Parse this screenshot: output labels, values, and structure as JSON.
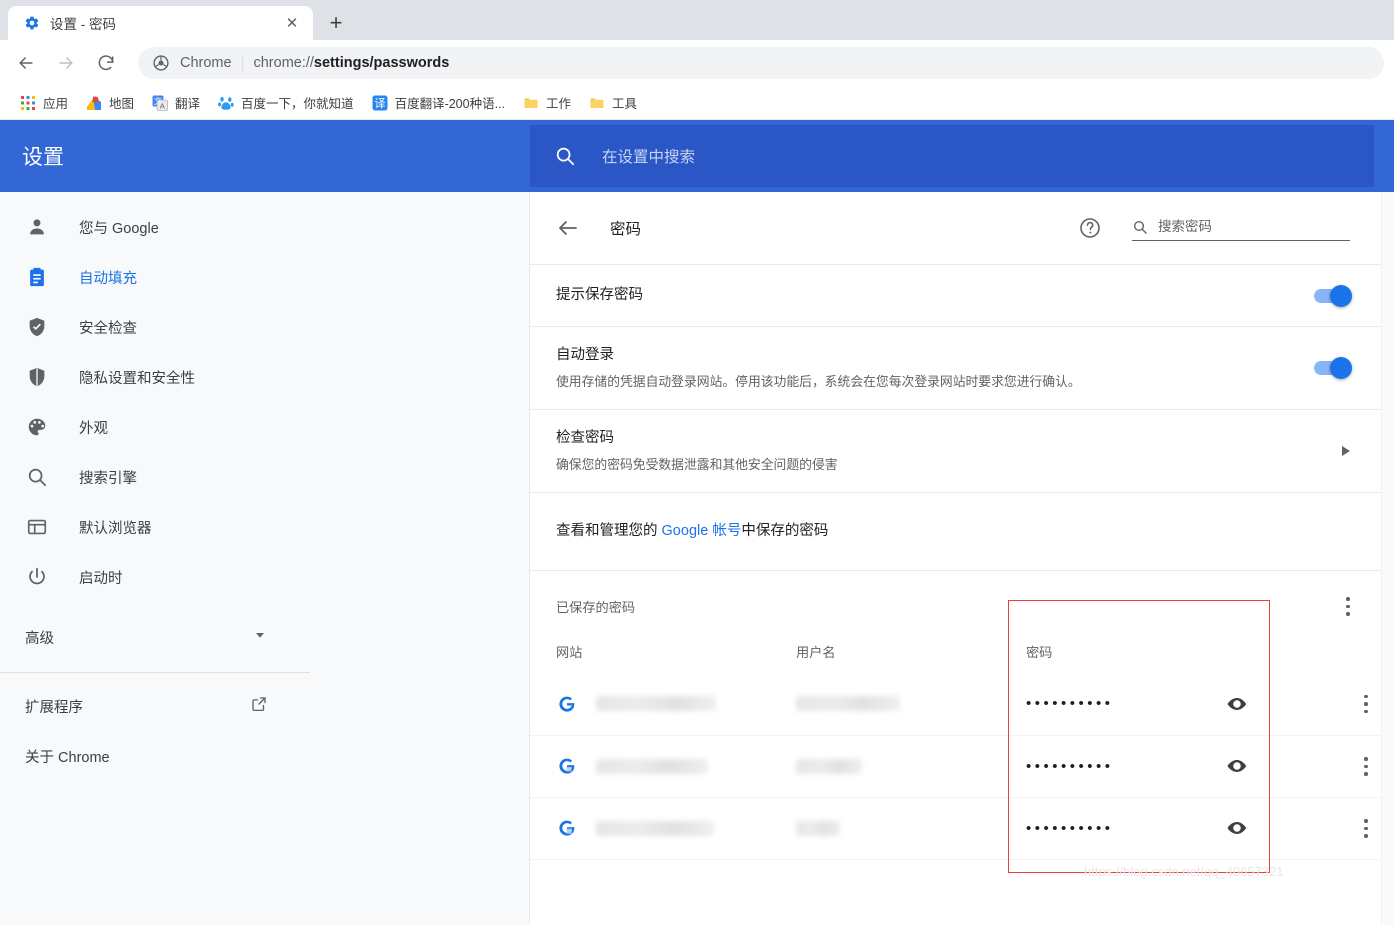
{
  "browser": {
    "tab": {
      "title": "设置 - 密码",
      "favicon": "gear-icon",
      "close_label": "✕"
    },
    "new_tab_label": "+",
    "nav": {
      "back": "←",
      "forward": "→",
      "reload": "⟳"
    },
    "omnibox": {
      "scheme_label": "Chrome",
      "separator": "|",
      "url_prefix": "chrome://",
      "url_bold": "settings/passwords"
    },
    "bookmarks": [
      {
        "icon": "apps-grid-icon",
        "label": "应用"
      },
      {
        "icon": "google-maps-icon",
        "label": "地图"
      },
      {
        "icon": "google-translate-icon",
        "label": "翻译"
      },
      {
        "icon": "baidu-icon",
        "label": "百度一下，你就知道"
      },
      {
        "icon": "baidu-translate-icon",
        "label": "百度翻译-200种语..."
      },
      {
        "icon": "folder-icon",
        "label": "工作"
      },
      {
        "icon": "folder-icon",
        "label": "工具"
      }
    ]
  },
  "settings": {
    "title": "设置",
    "search": {
      "placeholder": "在设置中搜索",
      "icon": "search-icon"
    },
    "sidebar": {
      "items": [
        {
          "icon": "person-icon",
          "label": "您与 Google",
          "active": false
        },
        {
          "icon": "autofill-clipboard-icon",
          "label": "自动填充",
          "active": true
        },
        {
          "icon": "shield-check-icon",
          "label": "安全检查",
          "active": false
        },
        {
          "icon": "shield-icon",
          "label": "隐私设置和安全性",
          "active": false
        },
        {
          "icon": "palette-icon",
          "label": "外观",
          "active": false
        },
        {
          "icon": "search-icon",
          "label": "搜索引擎",
          "active": false
        },
        {
          "icon": "browser-window-icon",
          "label": "默认浏览器",
          "active": false
        },
        {
          "icon": "power-icon",
          "label": "启动时",
          "active": false
        }
      ],
      "advanced": {
        "label": "高级",
        "icon": "chevron-down-icon"
      },
      "footer": [
        {
          "label": "扩展程序",
          "icon": "open-in-new-icon"
        },
        {
          "label": "关于 Chrome",
          "icon": ""
        }
      ]
    },
    "page": {
      "back_icon": "arrow-back-icon",
      "title": "密码",
      "help_icon": "help-circle-icon",
      "search": {
        "icon": "search-icon",
        "placeholder": "搜索密码"
      },
      "rows": [
        {
          "title": "提示保存密码",
          "sub": "",
          "control": "toggle-on"
        },
        {
          "title": "自动登录",
          "sub": "使用存储的凭据自动登录网站。停用该功能后，系统会在您每次登录网站时要求您进行确认。",
          "control": "toggle-on"
        },
        {
          "title": "检查密码",
          "sub": "确保您的密码免受数据泄露和其他安全问题的侵害",
          "control": "chevron-right"
        }
      ],
      "manage": {
        "prefix": "查看和管理您的 ",
        "link": "Google 帐号",
        "suffix": "中保存的密码"
      },
      "saved": {
        "label": "已保存的密码",
        "menu_icon": "kebab-menu-icon",
        "columns": {
          "site": "网站",
          "username": "用户名",
          "password": "密码"
        },
        "rows": [
          {
            "site_icon": "site-globe-icon",
            "site": "",
            "username": "",
            "password_mask": "••••••••••",
            "reveal_icon": "eye-icon",
            "menu_icon": "kebab-menu-icon"
          },
          {
            "site_icon": "site-globe-icon",
            "site": "",
            "username": "",
            "password_mask": "••••••••••",
            "reveal_icon": "eye-icon",
            "menu_icon": "kebab-menu-icon"
          },
          {
            "site_icon": "site-globe-icon",
            "site": "",
            "username": "",
            "password_mask": "••••••••••",
            "reveal_icon": "eye-icon",
            "menu_icon": "kebab-menu-icon"
          }
        ]
      }
    }
  },
  "annotation": {
    "highlight_color": "#e8403a"
  },
  "watermark": {
    "text": "https://blog.csdn.net/qq_40657321"
  },
  "colors": {
    "header_blue": "#3367d6",
    "search_blue": "#2a56c6",
    "accent": "#1a73e8",
    "link": "#1a73e8",
    "toggle_track": "#8ab4f8"
  }
}
